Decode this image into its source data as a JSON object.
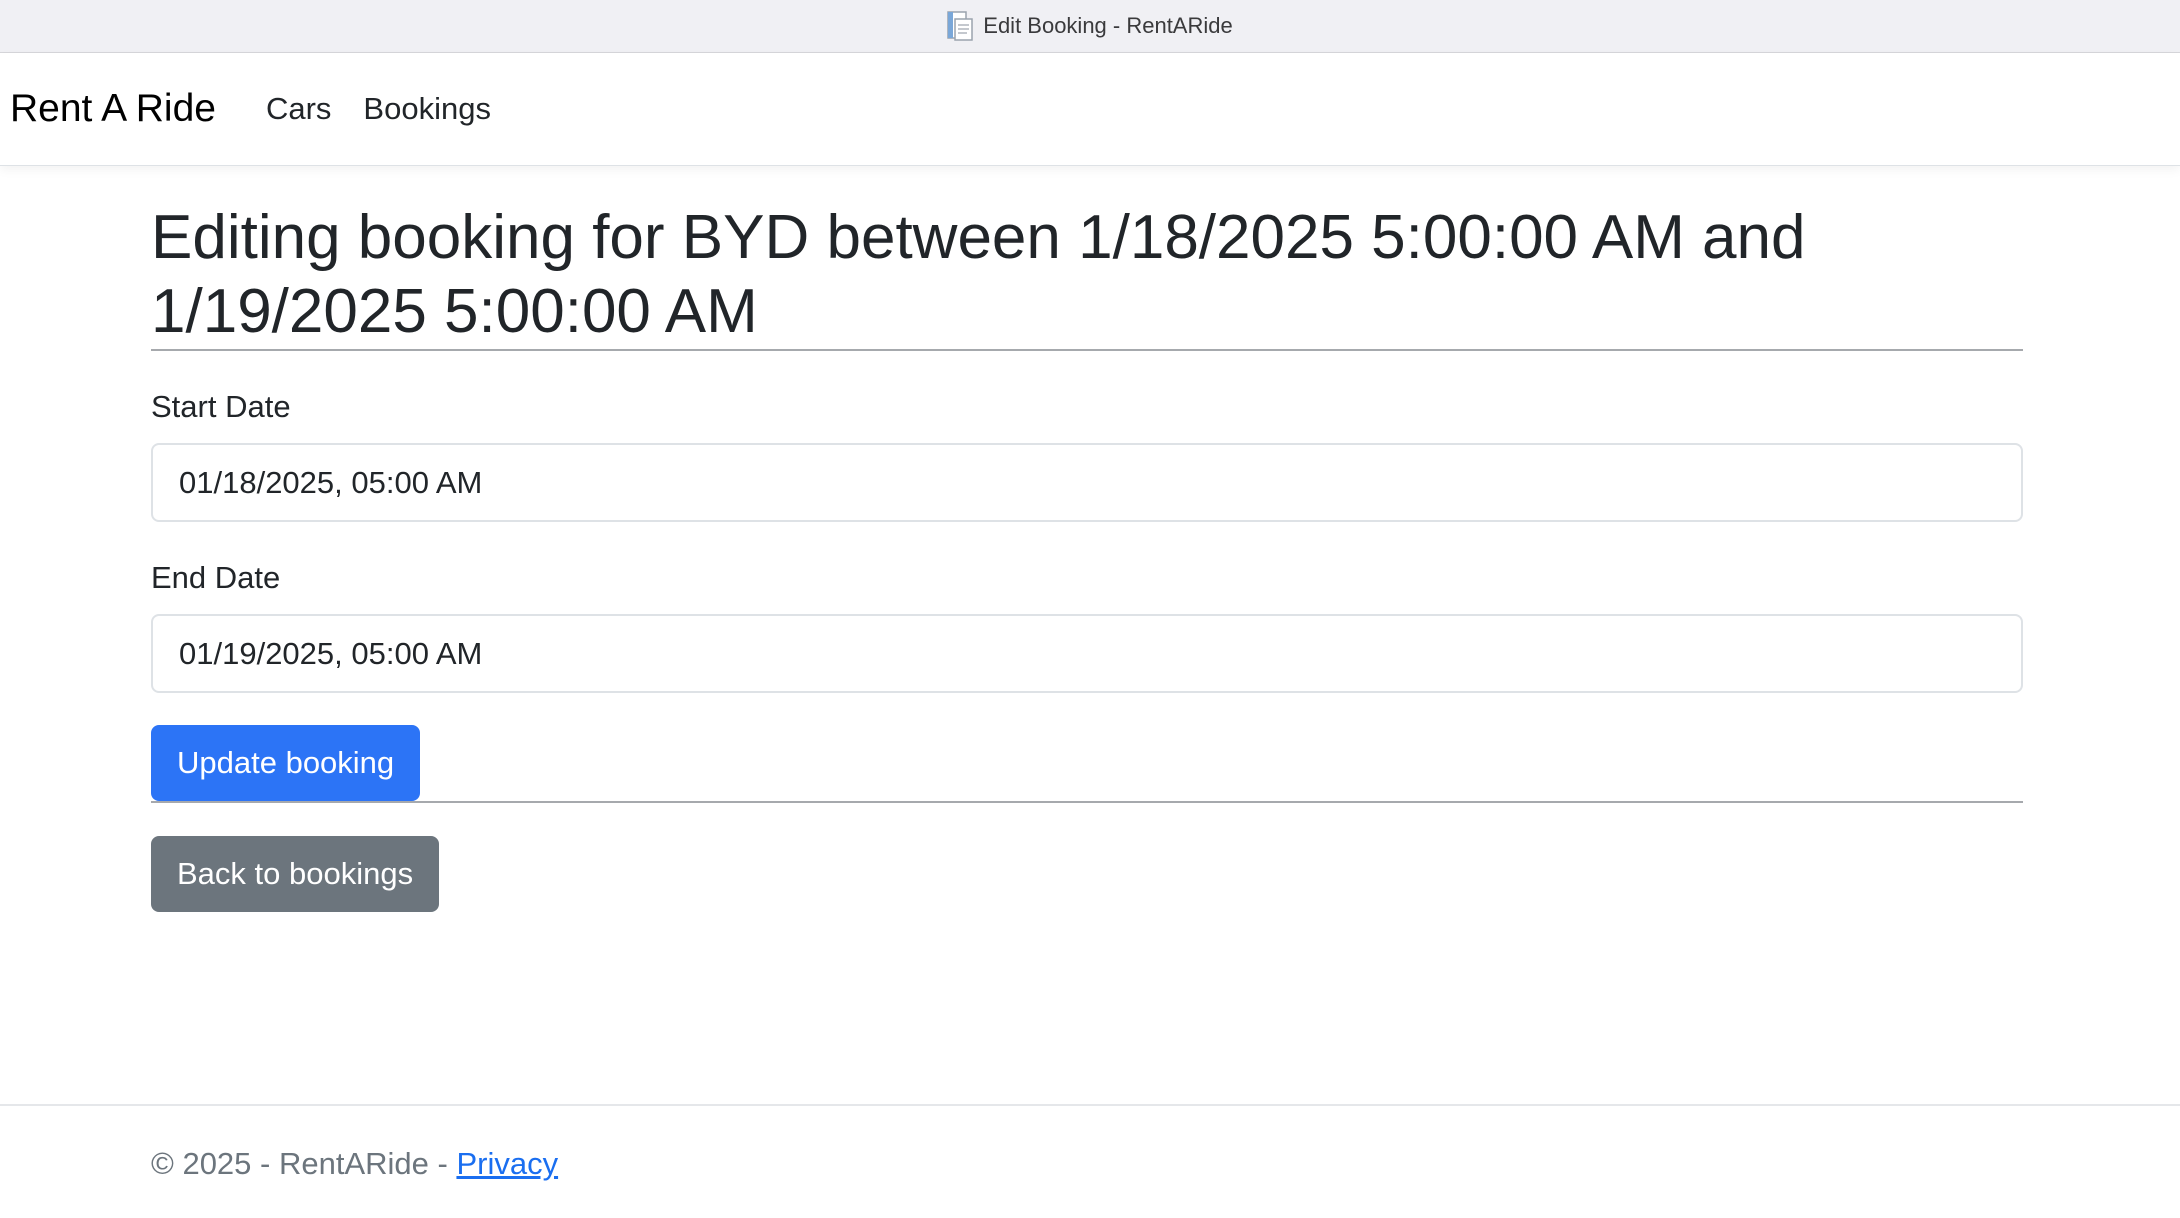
{
  "window": {
    "title": "Edit Booking - RentARide",
    "icon": "document-icon"
  },
  "navbar": {
    "brand": "Rent A Ride",
    "links": [
      "Cars",
      "Bookings"
    ]
  },
  "main": {
    "heading": "Editing booking for BYD between 1/18/2025 5:00:00 AM and 1/19/2025 5:00:00 AM",
    "start_date": {
      "label": "Start Date",
      "value": "01/18/2025, 05:00 AM"
    },
    "end_date": {
      "label": "End Date",
      "value": "01/19/2025, 05:00 AM"
    },
    "update_button": "Update booking",
    "back_button": "Back to bookings"
  },
  "footer": {
    "copyright": "© 2025 - RentARide - ",
    "privacy_link": "Privacy"
  },
  "colors": {
    "primary": "#2c74f6",
    "secondary": "#6c757d",
    "link": "#1a6ef0"
  }
}
